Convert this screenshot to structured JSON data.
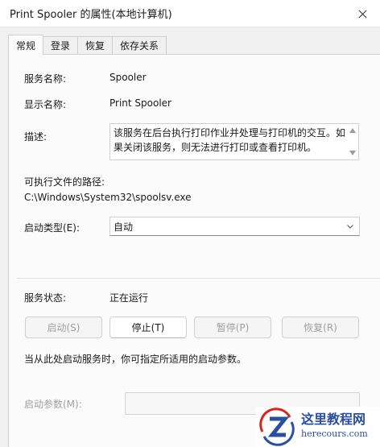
{
  "window": {
    "title": "Print Spooler 的属性(本地计算机)"
  },
  "tabs": [
    {
      "label": "常规",
      "active": true
    },
    {
      "label": "登录",
      "active": false
    },
    {
      "label": "恢复",
      "active": false
    },
    {
      "label": "依存关系",
      "active": false
    }
  ],
  "general": {
    "service_name_label": "服务名称:",
    "service_name": "Spooler",
    "display_name_label": "显示名称:",
    "display_name": "Print Spooler",
    "description_label": "描述:",
    "description": "该服务在后台执行打印作业并处理与打印机的交互。如果关闭该服务，则无法进行打印或查看打印机。",
    "path_label": "可执行文件的路径:",
    "path": "C:\\Windows\\System32\\spoolsv.exe",
    "startup_type_label": "启动类型(E):",
    "startup_type": "自动",
    "status_label": "服务状态:",
    "status": "正在运行",
    "buttons": {
      "start": "启动(S)",
      "stop": "停止(T)",
      "pause": "暂停(P)",
      "resume": "恢复(R)"
    },
    "hint": "当从此处启动服务时，你可指定所适用的启动参数。",
    "params_label": "启动参数(M):",
    "params_value": ""
  },
  "watermark": {
    "title": "这里教程网",
    "url": "herecours.com",
    "icon": "z-logo-icon"
  },
  "colors": {
    "window_bg": "#f0f0f0",
    "panel_bg": "#fbfbfb",
    "disabled_text": "#a0a0a0",
    "watermark_blue": "#2b4fa0",
    "watermark_red": "#d9261c"
  }
}
